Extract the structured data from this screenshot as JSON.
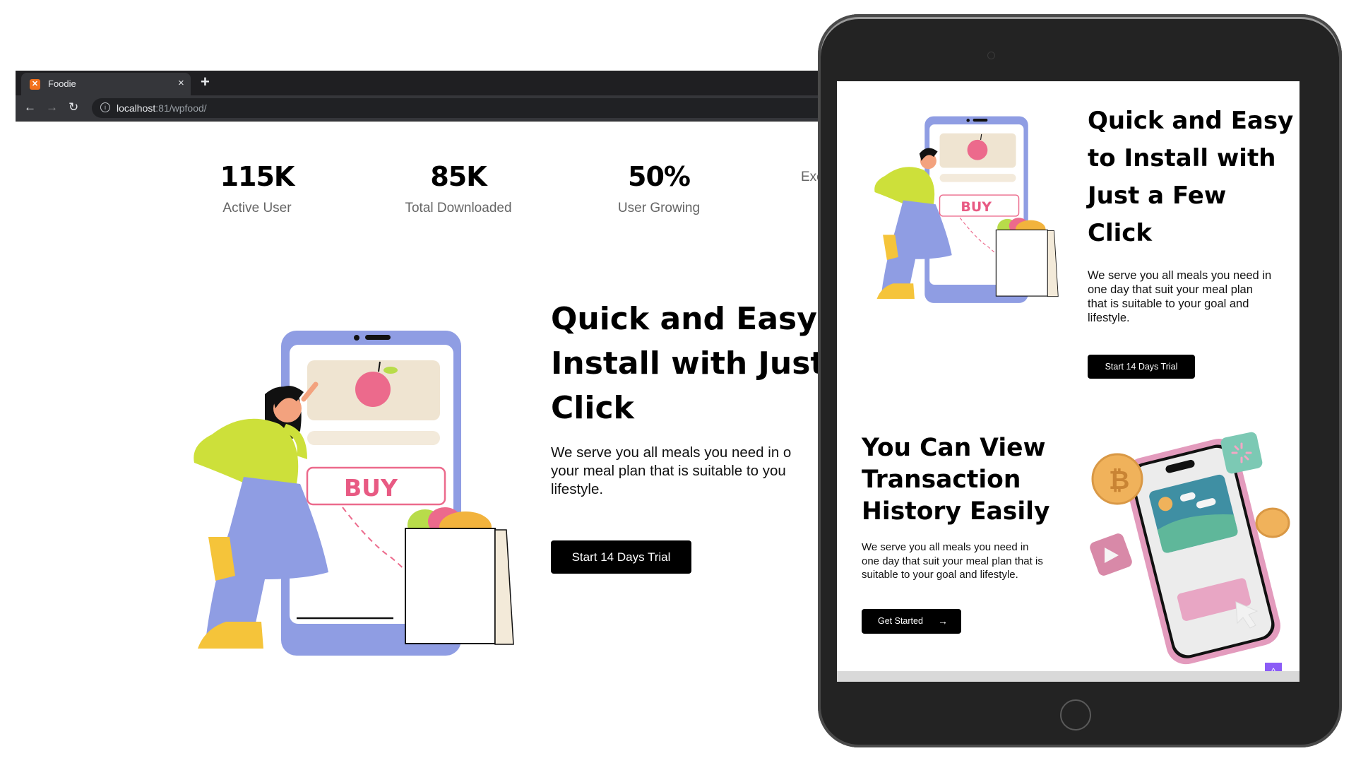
{
  "browser": {
    "tab": {
      "title": "Foodie",
      "favicon": "xampp-icon",
      "close_icon": "×"
    },
    "new_tab_icon": "+",
    "nav": {
      "back_icon": "←",
      "forward_icon": "→",
      "reload_icon": "↻"
    },
    "address": {
      "host": "localhost",
      "path": ":81/wpfood/",
      "info_icon": "i"
    }
  },
  "stats": [
    {
      "value": "115K",
      "label": "Active User"
    },
    {
      "value": "85K",
      "label": "Total Downloaded"
    },
    {
      "value": "50%",
      "label": "User Growing"
    },
    {
      "value": "",
      "label": "Exe"
    }
  ],
  "hero": {
    "title_lines": [
      "Quick and Easy t",
      "Install with Just",
      "Click"
    ],
    "description_lines": [
      "We serve you all meals you need in o",
      "your meal plan that is suitable to you",
      "lifestyle."
    ],
    "cta_label": "Start 14 Days Trial",
    "illustration": {
      "buy_label": "BUY"
    }
  },
  "tablet": {
    "section1": {
      "title_lines": [
        "Quick and Easy",
        "to Install with",
        "Just a Few",
        "Click"
      ],
      "description_lines": [
        "We serve you all meals you need in",
        "one day that suit your meal plan",
        "that is suitable to your goal and",
        "lifestyle."
      ],
      "cta_label": "Start 14 Days Trial",
      "illustration": {
        "buy_label": "BUY"
      }
    },
    "section2": {
      "title_lines": [
        "You Can View",
        "Transaction",
        "History Easily"
      ],
      "description_lines": [
        "We serve you all meals you need in",
        "one day that suit your meal plan that is",
        "suitable to your goal and lifestyle."
      ],
      "cta_label": "Get Started",
      "cta_icon": "→"
    },
    "scroll_top_icon": "^"
  },
  "colors": {
    "accent_purple": "#8b5cf6",
    "illustration_phone": "#8f9de3",
    "buy_pink": "#e85a83",
    "shirt_green": "#cde03a"
  }
}
